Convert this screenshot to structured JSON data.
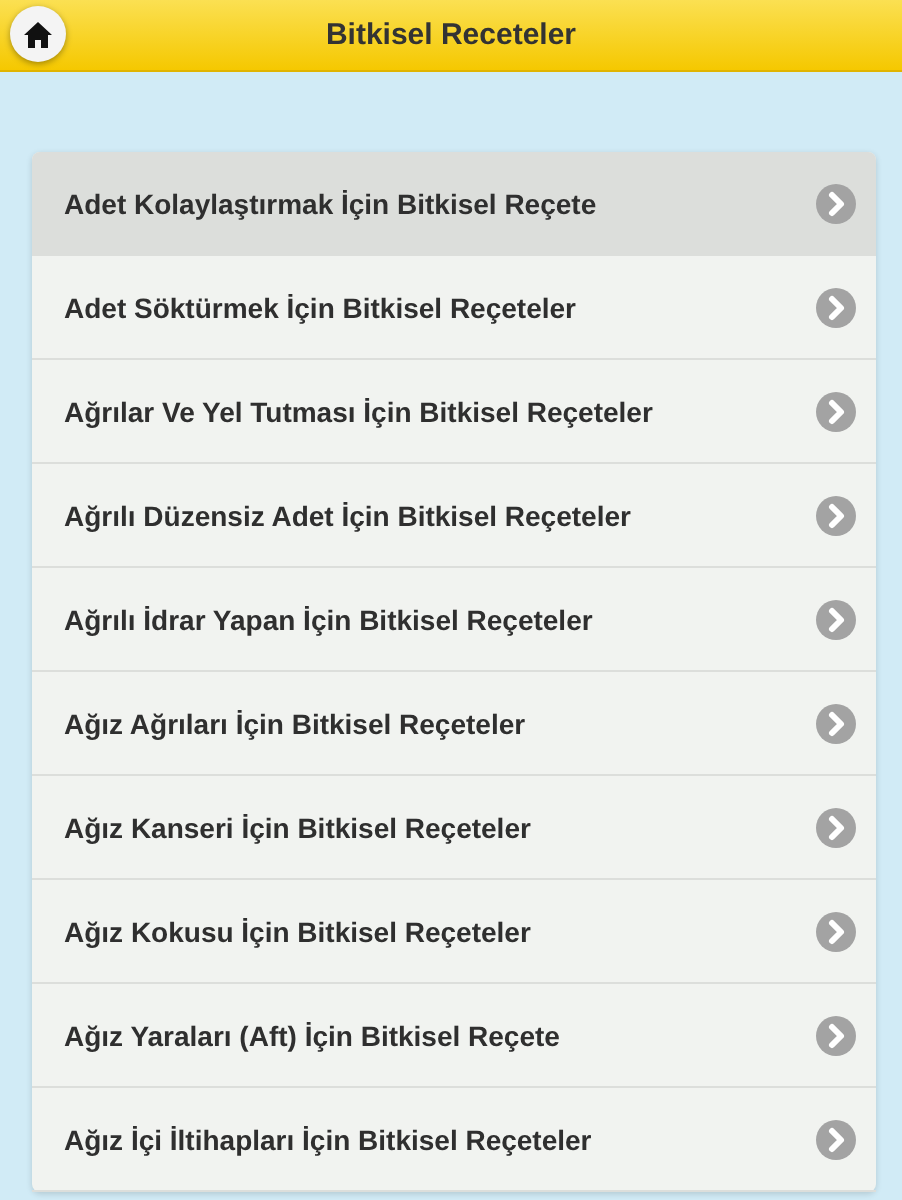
{
  "header": {
    "title": "Bitkisel Receteler"
  },
  "items": [
    {
      "label": "Adet Kolaylaştırmak İçin Bitkisel Reçete",
      "selected": true
    },
    {
      "label": "Adet Söktürmek İçin Bitkisel Reçeteler",
      "selected": false
    },
    {
      "label": "Ağrılar Ve Yel Tutması İçin Bitkisel Reçeteler",
      "selected": false
    },
    {
      "label": "Ağrılı Düzensiz Adet İçin Bitkisel Reçeteler",
      "selected": false
    },
    {
      "label": "Ağrılı İdrar Yapan İçin Bitkisel Reçeteler",
      "selected": false
    },
    {
      "label": "Ağız Ağrıları İçin Bitkisel Reçeteler",
      "selected": false
    },
    {
      "label": "Ağız Kanseri İçin Bitkisel Reçeteler",
      "selected": false
    },
    {
      "label": "Ağız Kokusu İçin Bitkisel Reçeteler",
      "selected": false
    },
    {
      "label": "Ağız Yaraları (Aft) İçin Bitkisel Reçete",
      "selected": false
    },
    {
      "label": "Ağız İçi İltihapları İçin Bitkisel Reçeteler",
      "selected": false
    }
  ]
}
